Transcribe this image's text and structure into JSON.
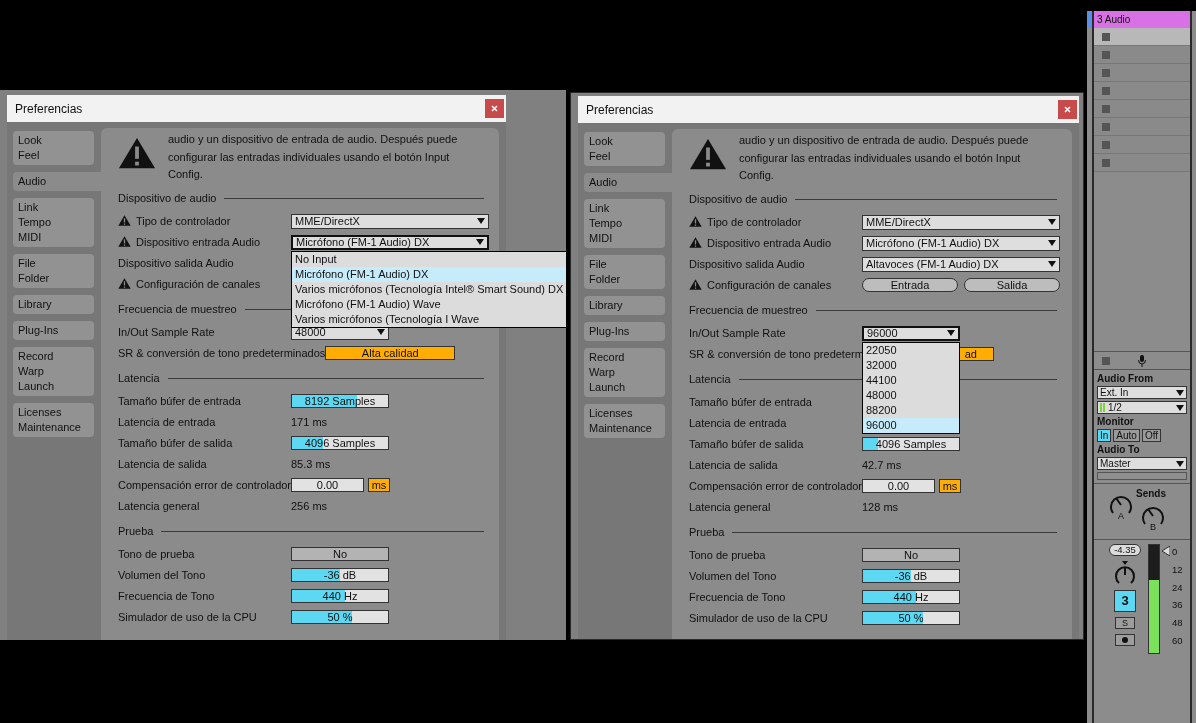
{
  "windows": [
    {
      "title": "Preferencias",
      "tabs": [
        {
          "lines": [
            "Look",
            "Feel"
          ],
          "selected": false
        },
        {
          "lines": [
            "Audio"
          ],
          "selected": true
        },
        {
          "lines": [
            "Link",
            "Tempo",
            "MIDI"
          ],
          "selected": false
        },
        {
          "lines": [
            "File",
            "Folder"
          ],
          "selected": false
        },
        {
          "lines": [
            "Library"
          ],
          "selected": false
        },
        {
          "lines": [
            "Plug-Ins"
          ],
          "selected": false
        },
        {
          "lines": [
            "Record",
            "Warp",
            "Launch"
          ],
          "selected": false
        },
        {
          "lines": [
            "Licenses",
            "Maintenance"
          ],
          "selected": false
        }
      ],
      "notice": "audio y un dispositivo de entrada de audio. Después puede configurar las entradas individuales usando el botón Input Config.",
      "sections": [
        {
          "title": "Dispositivo de audio",
          "rows": [
            {
              "kind": "menu",
              "label": "Tipo de controlador",
              "warning": true,
              "value": "MME/DirectX",
              "open": false
            },
            {
              "kind": "menu",
              "label": "Dispositivo entrada Audio",
              "warning": true,
              "value": "Micrófono (FM-1 Audio) DX",
              "open": true,
              "options": [
                {
                  "label": "No Input",
                  "selected": false
                },
                {
                  "label": "Micrófono (FM-1 Audio) DX",
                  "selected": true
                },
                {
                  "label": "Varios micrófonos (Tecnología Intel® Smart Sound) DX",
                  "selected": false
                },
                {
                  "label": "Micrófono (FM-1 Audio) Wave",
                  "selected": false
                },
                {
                  "label": "Varios micrófonos (Tecnología I Wave",
                  "selected": false
                }
              ]
            },
            {
              "kind": "label_only",
              "label": "Dispositivo salida Audio",
              "warning": false
            },
            {
              "kind": "label_only",
              "label": "Configuración de canales",
              "warning": true
            }
          ]
        },
        {
          "title": "Frecuencia de muestreo",
          "rows": [
            {
              "kind": "short_menu",
              "label": "In/Out Sample Rate",
              "warning": false,
              "value": "48000",
              "open": false
            },
            {
              "kind": "button",
              "label": "SR & conversión de tono predeterminados",
              "warning": false,
              "value": "Alta calidad"
            }
          ]
        },
        {
          "title": "Latencia",
          "rows": [
            {
              "kind": "slider",
              "label": "Tamaño búfer de entrada",
              "warning": false,
              "value": "8192 Samples",
              "level": 0.68
            },
            {
              "kind": "text",
              "label": "Latencia de entrada",
              "warning": false,
              "value": "171 ms"
            },
            {
              "kind": "slider",
              "label": "Tamaño búfer de salida",
              "warning": false,
              "value": "4096 Samples",
              "level": 0.32
            },
            {
              "kind": "text",
              "label": "Latencia de salida",
              "warning": false,
              "value": "85.3 ms"
            },
            {
              "kind": "number",
              "label": "Compensación error de controlador",
              "warning": false,
              "value": "0.00",
              "unit": "ms"
            },
            {
              "kind": "text",
              "label": "Latencia general",
              "warning": false,
              "value": "256 ms"
            }
          ]
        },
        {
          "title": "Prueba",
          "rows": [
            {
              "kind": "toggle",
              "label": "Tono de prueba",
              "warning": false,
              "value": "No"
            },
            {
              "kind": "slider",
              "label": "Volumen del Tono",
              "warning": false,
              "value": "-36 dB",
              "level": 0.5
            },
            {
              "kind": "slider",
              "label": "Frecuencia de Tono",
              "warning": false,
              "value": "440 Hz",
              "level": 0.55
            },
            {
              "kind": "slider",
              "label": "Simulador de uso de la CPU",
              "warning": false,
              "value": "50 %",
              "level": 0.62
            }
          ]
        }
      ]
    },
    {
      "title": "Preferencias",
      "tabs": [
        {
          "lines": [
            "Look",
            "Feel"
          ],
          "selected": false
        },
        {
          "lines": [
            "Audio"
          ],
          "selected": true
        },
        {
          "lines": [
            "Link",
            "Tempo",
            "MIDI"
          ],
          "selected": false
        },
        {
          "lines": [
            "File",
            "Folder"
          ],
          "selected": false
        },
        {
          "lines": [
            "Library"
          ],
          "selected": false
        },
        {
          "lines": [
            "Plug-Ins"
          ],
          "selected": false
        },
        {
          "lines": [
            "Record",
            "Warp",
            "Launch"
          ],
          "selected": false
        },
        {
          "lines": [
            "Licenses",
            "Maintenance"
          ],
          "selected": false
        }
      ],
      "notice": "audio y un dispositivo de entrada de audio. Después puede configurar las entradas individuales usando el botón Input Config.",
      "sections": [
        {
          "title": "Dispositivo de audio",
          "rows": [
            {
              "kind": "menu",
              "label": "Tipo de controlador",
              "warning": true,
              "value": "MME/DirectX",
              "open": false
            },
            {
              "kind": "menu",
              "label": "Dispositivo entrada Audio",
              "warning": true,
              "value": "Micrófono (FM-1 Audio) DX",
              "open": false
            },
            {
              "kind": "menu",
              "label": "Dispositivo salida Audio",
              "warning": false,
              "value": "Altavoces (FM-1 Audio) DX",
              "open": false
            },
            {
              "kind": "pair",
              "label": "Configuración de canales",
              "warning": true,
              "buttons": [
                "Entrada",
                "Salida"
              ]
            }
          ]
        },
        {
          "title": "Frecuencia de muestreo",
          "rows": [
            {
              "kind": "short_menu",
              "label": "In/Out Sample Rate",
              "warning": false,
              "value": "96000",
              "open": true,
              "options": [
                {
                  "label": "22050",
                  "selected": false
                },
                {
                  "label": "32000",
                  "selected": false
                },
                {
                  "label": "44100",
                  "selected": false
                },
                {
                  "label": "48000",
                  "selected": false
                },
                {
                  "label": "88200",
                  "selected": false
                },
                {
                  "label": "96000",
                  "selected": true
                }
              ]
            },
            {
              "kind": "cut_button",
              "label": "SR & conversión de tono predeterm",
              "warning": false,
              "value": "ad"
            }
          ]
        },
        {
          "title": "Latencia",
          "rows": [
            {
              "kind": "label_only",
              "label": "Tamaño búfer de entrada",
              "warning": false
            },
            {
              "kind": "label_only",
              "label": "Latencia de entrada",
              "warning": false
            },
            {
              "kind": "slider",
              "label": "Tamaño búfer de salida",
              "warning": false,
              "value": "4096 Samples",
              "level": 0.16
            },
            {
              "kind": "text",
              "label": "Latencia de salida",
              "warning": false,
              "value": "42.7 ms"
            },
            {
              "kind": "number",
              "label": "Compensación error de controlador",
              "warning": false,
              "value": "0.00",
              "unit": "ms"
            },
            {
              "kind": "text",
              "label": "Latencia general",
              "warning": false,
              "value": "128 ms"
            }
          ]
        },
        {
          "title": "Prueba",
          "rows": [
            {
              "kind": "toggle",
              "label": "Tono de prueba",
              "warning": false,
              "value": "No"
            },
            {
              "kind": "slider",
              "label": "Volumen del Tono",
              "warning": false,
              "value": "-36 dB",
              "level": 0.5
            },
            {
              "kind": "slider",
              "label": "Frecuencia de Tono",
              "warning": false,
              "value": "440 Hz",
              "level": 0.55
            },
            {
              "kind": "slider",
              "label": "Simulador de uso de la CPU",
              "warning": false,
              "value": "50 %",
              "level": 0.62
            }
          ]
        }
      ]
    }
  ],
  "track": {
    "name": "3 Audio",
    "clip_slots": [
      {
        "selected": true
      },
      {
        "selected": false
      },
      {
        "selected": false
      },
      {
        "selected": false
      },
      {
        "selected": false
      },
      {
        "selected": false
      },
      {
        "selected": false
      },
      {
        "selected": false
      }
    ],
    "audio_from_label": "Audio From",
    "audio_from": "Ext. In",
    "channel": "1/2",
    "monitor_label": "Monitor",
    "monitor": [
      {
        "label": "In",
        "selected": true
      },
      {
        "label": "Auto",
        "selected": false
      },
      {
        "label": "Off",
        "selected": false
      }
    ],
    "audio_to_label": "Audio To",
    "audio_to": "Master",
    "sends_label": "Sends",
    "sends": [
      "A",
      "B"
    ],
    "volume": "-4.35",
    "number": "3",
    "solo": "S",
    "meter": {
      "level": 0.68
    },
    "scale": [
      "0",
      "12",
      "24",
      "36",
      "48",
      "60"
    ]
  }
}
